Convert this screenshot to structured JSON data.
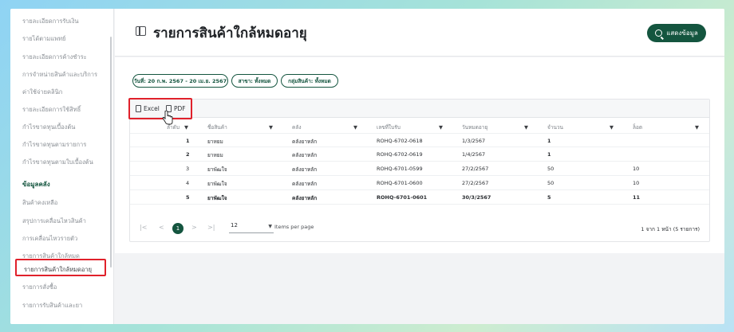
{
  "sidebar": {
    "items_top": [
      "รายละเอียดการรับเงิน",
      "รายได้ตามแพทย์",
      "รายละเอียดการค้างชำระ",
      "การจำหน่ายสินค้าและบริการ",
      "ค่าใช้จ่ายคลินิก",
      "รายละเอียดการใช้สิทธิ์",
      "กำไรขาดทุนเบื้องต้น",
      "กำไรขาดทุนตามรายการ",
      "กำไรขาดทุนตามใบเบื้องต้น"
    ],
    "section": "ข้อมูลคลัง",
    "items_bottom": [
      "สินค้าคงเหลือ",
      "สรุปการเคลื่อนไหวสินค้า",
      "การเคลื่อนไหวรายตัว",
      "รายการสินค้าใกล้หมด"
    ],
    "active_item": "รายการสินค้าใกล้หมดอายุ",
    "items_after": [
      "รายการสั่งซื้อ",
      "รายการรับสินค้าและยา"
    ]
  },
  "header": {
    "title": "รายการสินค้าใกล้หมดอายุ",
    "show_button": "แสดงข้อมูล"
  },
  "filters": {
    "date": "วันที่: 20 ก.พ. 2567 - 20 เม.ย. 2567",
    "branch": "สาขา: ทั้งหมด",
    "group": "กลุ่มสินค้า: ทั้งหมด"
  },
  "toolbar": {
    "excel": "Excel",
    "pdf": "PDF"
  },
  "table": {
    "headers": [
      "ลำดับ",
      "ชื่อสินค้า",
      "คลัง",
      "เลขที่ใบรับ",
      "วันหมดอายุ",
      "จำนวน",
      "ล็อต"
    ],
    "rows": [
      [
        "1",
        "ยาหยม",
        "คลังยาหลัก",
        "ROHQ-6702-0618",
        "1/3/2567",
        "1",
        ""
      ],
      [
        "2",
        "ยาหยม",
        "คลังยาหลัก",
        "ROHQ-6702-0619",
        "1/4/2567",
        "1",
        ""
      ],
      [
        "3",
        "ยาพัฒใจ",
        "คลังยาหลัก",
        "ROHQ-6701-0599",
        "27/2/2567",
        "50",
        "10"
      ],
      [
        "4",
        "ยาพัฒใจ",
        "คลังยาหลัก",
        "ROHQ-6701-0600",
        "27/2/2567",
        "50",
        "10"
      ],
      [
        "5",
        "ยาพัฒใจ",
        "คลังยาหลัก",
        "ROHQ-6701-0601",
        "30/3/2567",
        "5",
        "11"
      ]
    ]
  },
  "pagination": {
    "first": "|<",
    "prev": "<",
    "current": "1",
    "next": ">",
    "last": ">|",
    "per_page": "12",
    "per_page_label": "Items per page",
    "range": "1 จาก 1 หน้า (5 รายการ)"
  }
}
